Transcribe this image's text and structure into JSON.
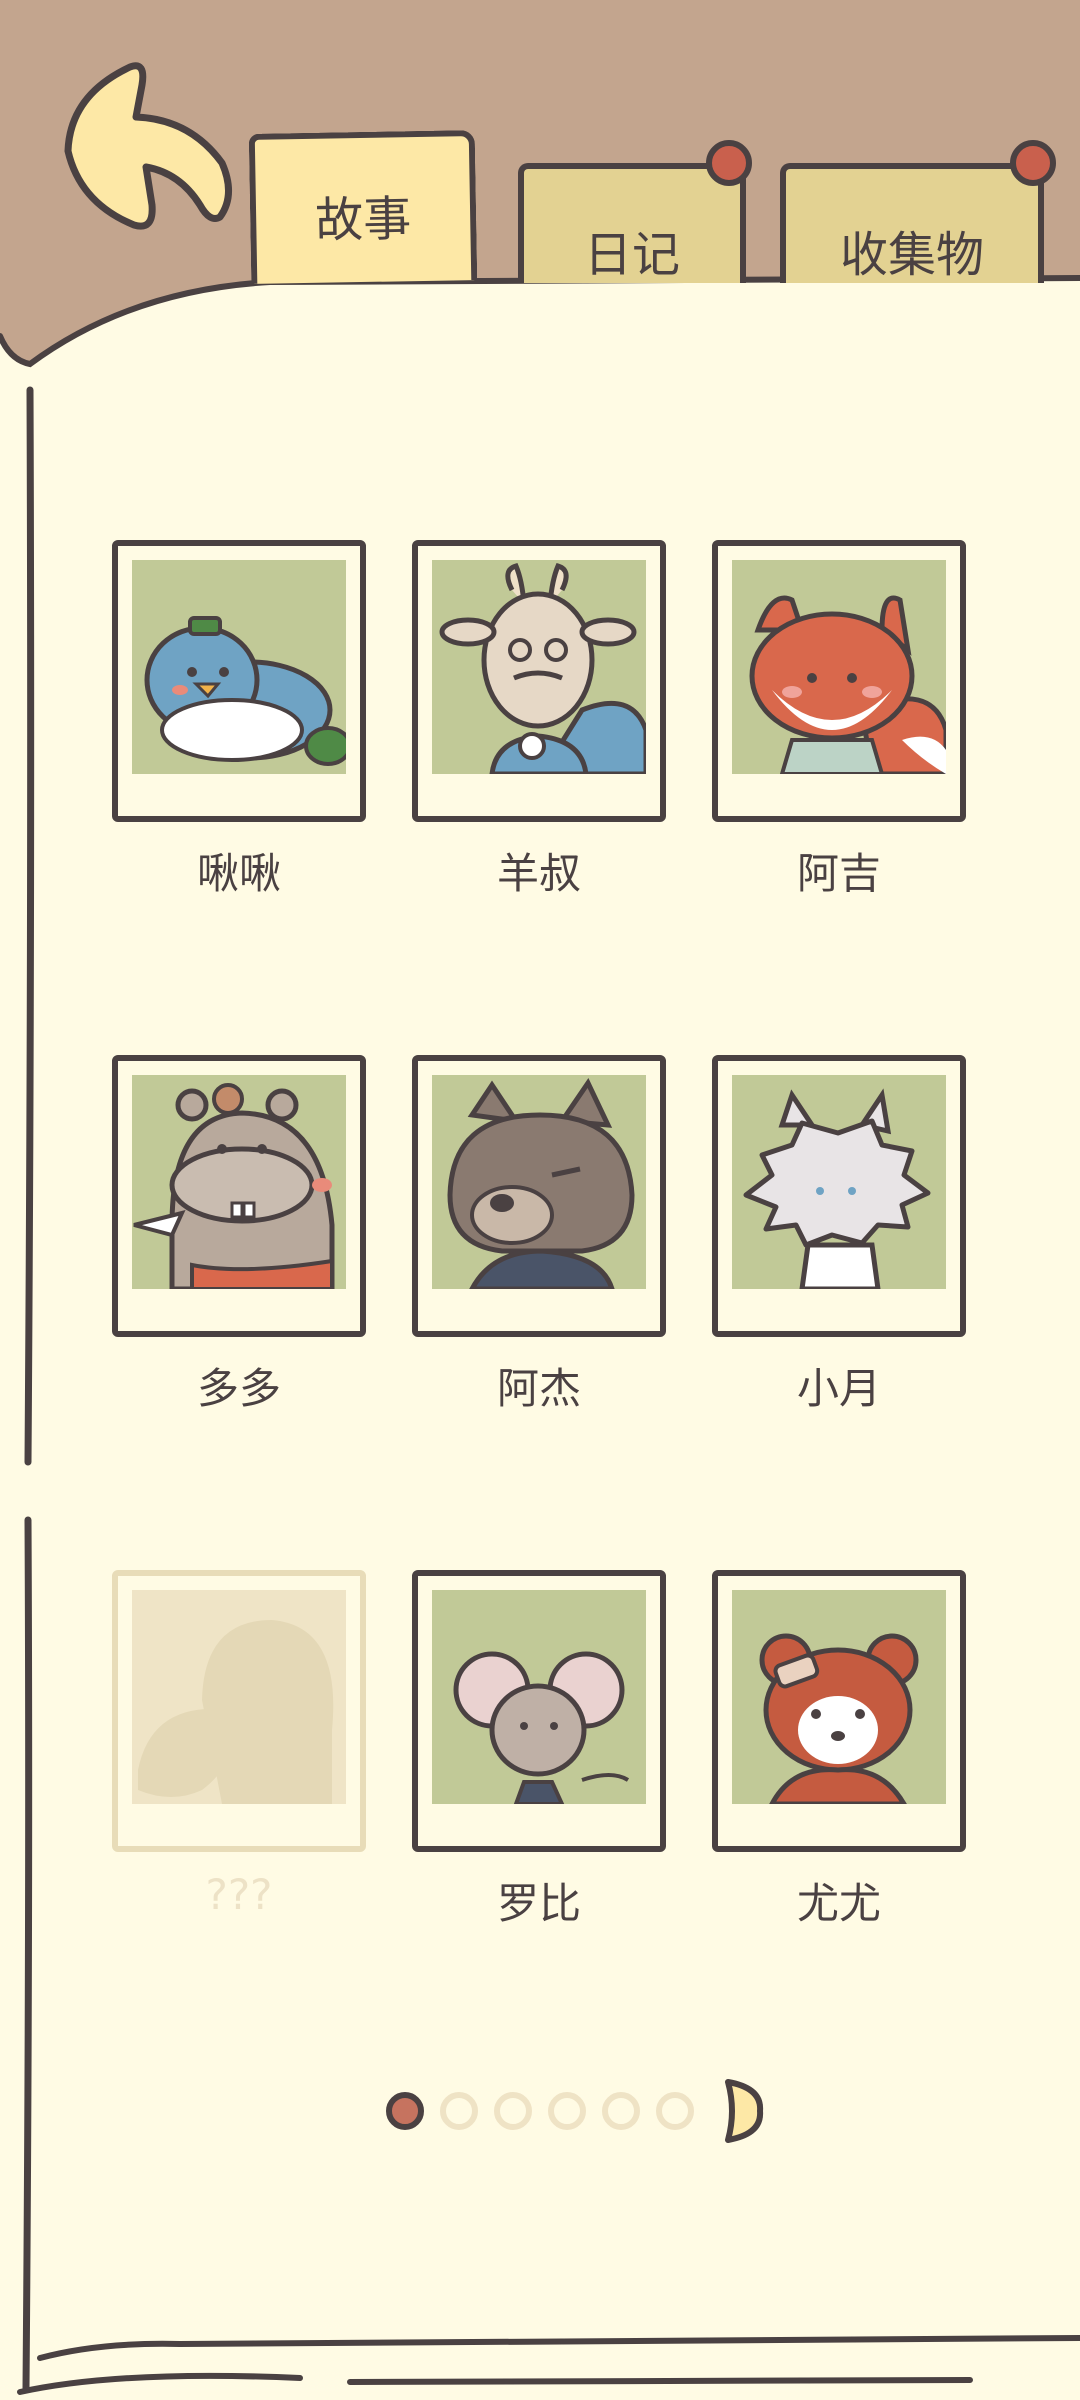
{
  "tabs": [
    {
      "label": "故事",
      "active": true
    },
    {
      "label": "日记",
      "active": false,
      "badge": true
    },
    {
      "label": "收集物",
      "active": false,
      "badge": true
    }
  ],
  "characters": [
    {
      "name": "啾啾",
      "icon": "blue-bird-icon",
      "unlocked": true
    },
    {
      "name": "羊叔",
      "icon": "goat-icon",
      "unlocked": true
    },
    {
      "name": "阿吉",
      "icon": "fox-icon",
      "unlocked": true
    },
    {
      "name": "多多",
      "icon": "hippo-icon",
      "unlocked": true
    },
    {
      "name": "阿杰",
      "icon": "wolf-icon",
      "unlocked": true
    },
    {
      "name": "小月",
      "icon": "white-cat-icon",
      "unlocked": true
    },
    {
      "name": "???",
      "icon": "locked-silhouette-icon",
      "unlocked": false
    },
    {
      "name": "罗比",
      "icon": "mouse-icon",
      "unlocked": true
    },
    {
      "name": "尤尤",
      "icon": "red-panda-icon",
      "unlocked": true
    }
  ],
  "pagination": {
    "current": 1,
    "total": 6
  },
  "colors": {
    "paper": "#fffbe4",
    "header": "#c3a58e",
    "outline": "#4a4142",
    "tab_active": "#fde8a6",
    "tab_idle": "#e3d292",
    "badge": "#c9604d",
    "photo_bg": "#c1c997"
  }
}
